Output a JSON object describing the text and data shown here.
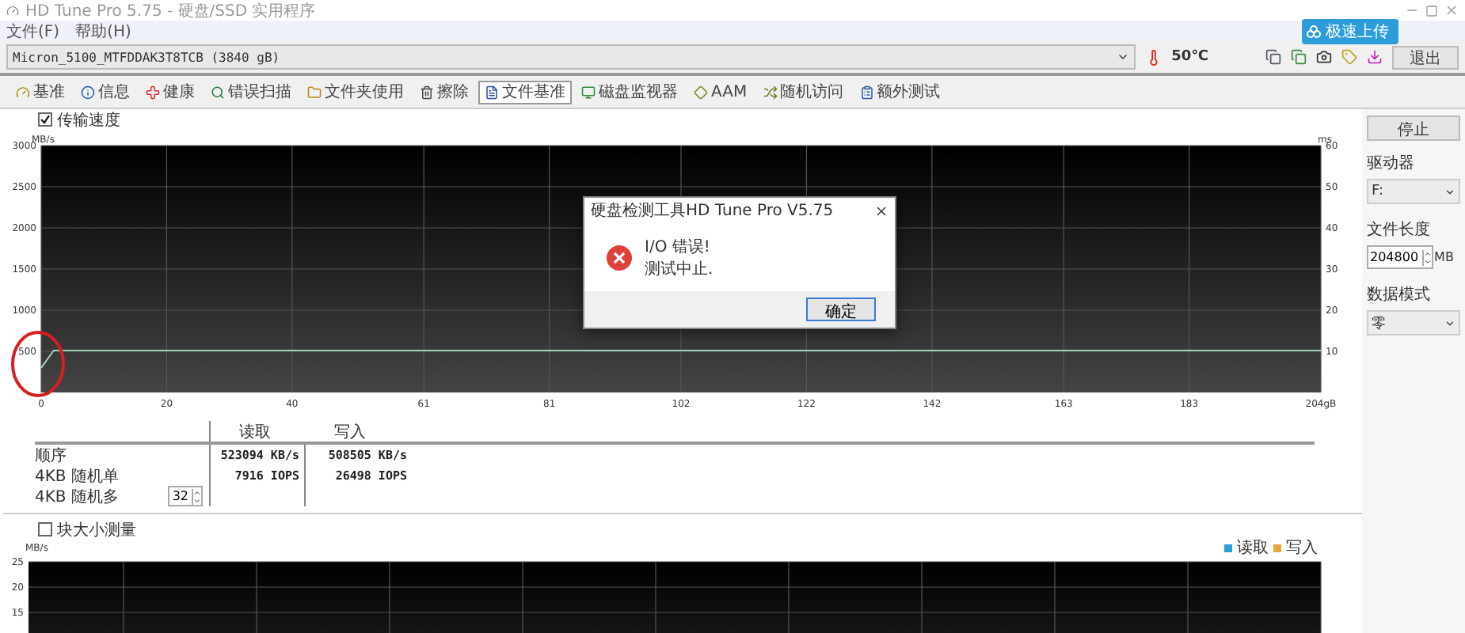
{
  "window": {
    "title": "HD Tune Pro 5.75 - 硬盘/SSD 实用程序"
  },
  "menu": [
    "文件(F)",
    "帮助(H)"
  ],
  "drive_bar": {
    "drive": "Micron_5100_MTFDDAK3T8TCB (3840 gB)",
    "temperature": "50℃",
    "exit_button": "退出"
  },
  "upload_badge": {
    "label": "极速上传"
  },
  "tabs": [
    {
      "label": "基准",
      "selected": false
    },
    {
      "label": "信息",
      "selected": false
    },
    {
      "label": "健康",
      "selected": false
    },
    {
      "label": "错误扫描",
      "selected": false
    },
    {
      "label": "文件夹使用",
      "selected": false
    },
    {
      "label": "擦除",
      "selected": false
    },
    {
      "label": "文件基准",
      "selected": true
    },
    {
      "label": "磁盘监视器",
      "selected": false
    },
    {
      "label": "AAM",
      "selected": false
    },
    {
      "label": "随机访问",
      "selected": false
    },
    {
      "label": "额外测试",
      "selected": false
    }
  ],
  "transfer_speed": {
    "label": "传输速度",
    "checked": true
  },
  "speed_chart": {
    "chart_data": {
      "type": "line",
      "grid": true,
      "ylabel": "MB/s",
      "y2label": "ms",
      "x": [
        0,
        2,
        20,
        40,
        61,
        81,
        102,
        122,
        142,
        163,
        183,
        204
      ],
      "xlim": [
        0,
        204
      ],
      "ylim": [
        0,
        3000
      ],
      "y2lim": [
        0,
        60
      ],
      "yticks": [
        500,
        1000,
        1500,
        2000,
        2500,
        3000
      ],
      "y2ticks": [
        10,
        20,
        30,
        40,
        50,
        60
      ],
      "xticks": [
        0,
        20,
        40,
        61,
        81,
        102,
        122,
        142,
        163,
        183,
        {
          "value": 204,
          "label": "204gB"
        }
      ],
      "series": [
        {
          "color": "#9fd3b8",
          "values": [
            300,
            510,
            510,
            510,
            510,
            510,
            510,
            510,
            510,
            510,
            510,
            510
          ]
        }
      ]
    }
  },
  "results": {
    "columns": [
      "读取",
      "写入"
    ],
    "rows": [
      {
        "label": "顺序",
        "read": "523094 KB/s",
        "write": "508505 KB/s"
      },
      {
        "label": "4KB 随机单",
        "read": "7916 IOPS",
        "write": "26498 IOPS"
      },
      {
        "label": "4KB 随机多",
        "queue": "32"
      }
    ]
  },
  "block_size": {
    "label": "块大小测量",
    "checked": false
  },
  "block_chart": {
    "legend": [
      {
        "label": "读取",
        "color": "#2a9fd6"
      },
      {
        "label": "写入",
        "color": "#e8a33a"
      }
    ],
    "unit": "MB/s",
    "axis_labels": [
      "25",
      "20",
      "15"
    ]
  },
  "side": {
    "stop_button": "停止",
    "drive_label": "驱动器",
    "drive": "F:",
    "length_label": "文件长度",
    "length": "204800",
    "length_unit": "MB",
    "mode_label": "数据模式",
    "mode": "零"
  },
  "dialog": {
    "title": "硬盘检测工具HD Tune Pro V5.75",
    "lines": [
      "I/O 错误!",
      "测试中止."
    ],
    "ok_button": "确定"
  }
}
